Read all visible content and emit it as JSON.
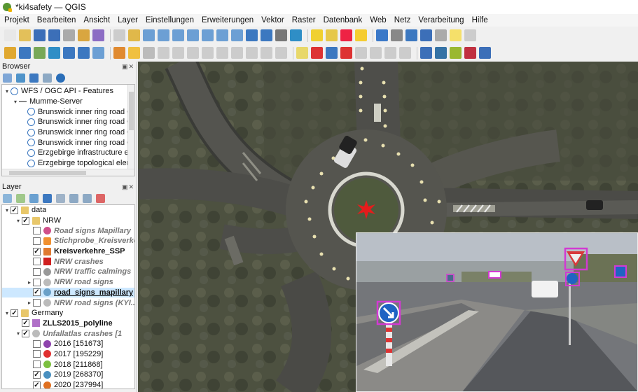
{
  "window": {
    "title": "*ki4safety — QGIS"
  },
  "menu": [
    "Projekt",
    "Bearbeiten",
    "Ansicht",
    "Layer",
    "Einstellungen",
    "Erweiterungen",
    "Vektor",
    "Raster",
    "Datenbank",
    "Web",
    "Netz",
    "Verarbeitung",
    "Hilfe"
  ],
  "browser": {
    "title": "Browser",
    "items": [
      {
        "label": "WFS / OGC API - Features",
        "level": 0,
        "expanded": true
      },
      {
        "label": "Mumme-Server",
        "level": 1,
        "expanded": true
      },
      {
        "label": "Brunswick inner ring road CA",
        "level": 2
      },
      {
        "label": "Brunswick inner ring road Op",
        "level": 2
      },
      {
        "label": "Brunswick inner ring road Op",
        "level": 2
      },
      {
        "label": "Brunswick inner ring road Op",
        "level": 2
      },
      {
        "label": "Erzgebirge infrastructure ele",
        "level": 2
      },
      {
        "label": "Erzgebirge topological elem",
        "level": 2
      }
    ]
  },
  "layers": {
    "title": "Layer",
    "items": [
      {
        "label": "data",
        "level": 0,
        "type": "group",
        "checked": true,
        "expand": "▾"
      },
      {
        "label": "NRW",
        "level": 1,
        "type": "group",
        "checked": true,
        "expand": "▾"
      },
      {
        "label": "Road signs Mapillary",
        "level": 2,
        "checked": false,
        "style": "ital",
        "symbol": "dot-pink"
      },
      {
        "label": "Stichprobe_Kreisverkehre",
        "level": 2,
        "checked": false,
        "style": "ital",
        "symbol": "hex-orange"
      },
      {
        "label": "Kreisverkehre_SSP",
        "level": 2,
        "checked": true,
        "style": "bold",
        "symbol": "pen-orange"
      },
      {
        "label": "NRW crashes",
        "level": 2,
        "checked": false,
        "style": "ital",
        "symbol": "square-red"
      },
      {
        "label": "NRW traffic calmings",
        "level": 2,
        "checked": false,
        "style": "ital",
        "symbol": "dot-grey"
      },
      {
        "label": "NRW road signs",
        "level": 2,
        "checked": false,
        "style": "ital",
        "symbol": "dots-grey",
        "expand": "▸"
      },
      {
        "label": "road_signs_mapillary",
        "level": 2,
        "checked": true,
        "style": "bold under",
        "symbol": "dot-blue",
        "selected": true
      },
      {
        "label": "NRW road signs (KYI...",
        "level": 2,
        "checked": false,
        "style": "ital",
        "symbol": "dots-grey",
        "expand": "▸"
      },
      {
        "label": "Germany",
        "level": 0,
        "type": "group",
        "checked": true,
        "expand": "▾"
      },
      {
        "label": "ZLLS2015_polyline",
        "level": 1,
        "checked": true,
        "style": "bold",
        "symbol": "rect-purple"
      },
      {
        "label": "Unfallatlas crashes [1",
        "level": 1,
        "checked": true,
        "style": "ital",
        "symbol": "dots-grey",
        "expand": "▾"
      },
      {
        "label": "2016 [151673]",
        "level": 2,
        "checked": false,
        "symbol": "dot-purple"
      },
      {
        "label": "2017 [195229]",
        "level": 2,
        "checked": false,
        "symbol": "dot-red"
      },
      {
        "label": "2018 [211868]",
        "level": 2,
        "checked": false,
        "symbol": "dot-green"
      },
      {
        "label": "2019 [268370]",
        "level": 2,
        "checked": true,
        "symbol": "dot-teal"
      },
      {
        "label": "2020 [237994]",
        "level": 2,
        "checked": true,
        "symbol": "dot-orange"
      }
    ]
  },
  "colors": {
    "accent": "#589632",
    "selected_row": "#cde8ff"
  }
}
